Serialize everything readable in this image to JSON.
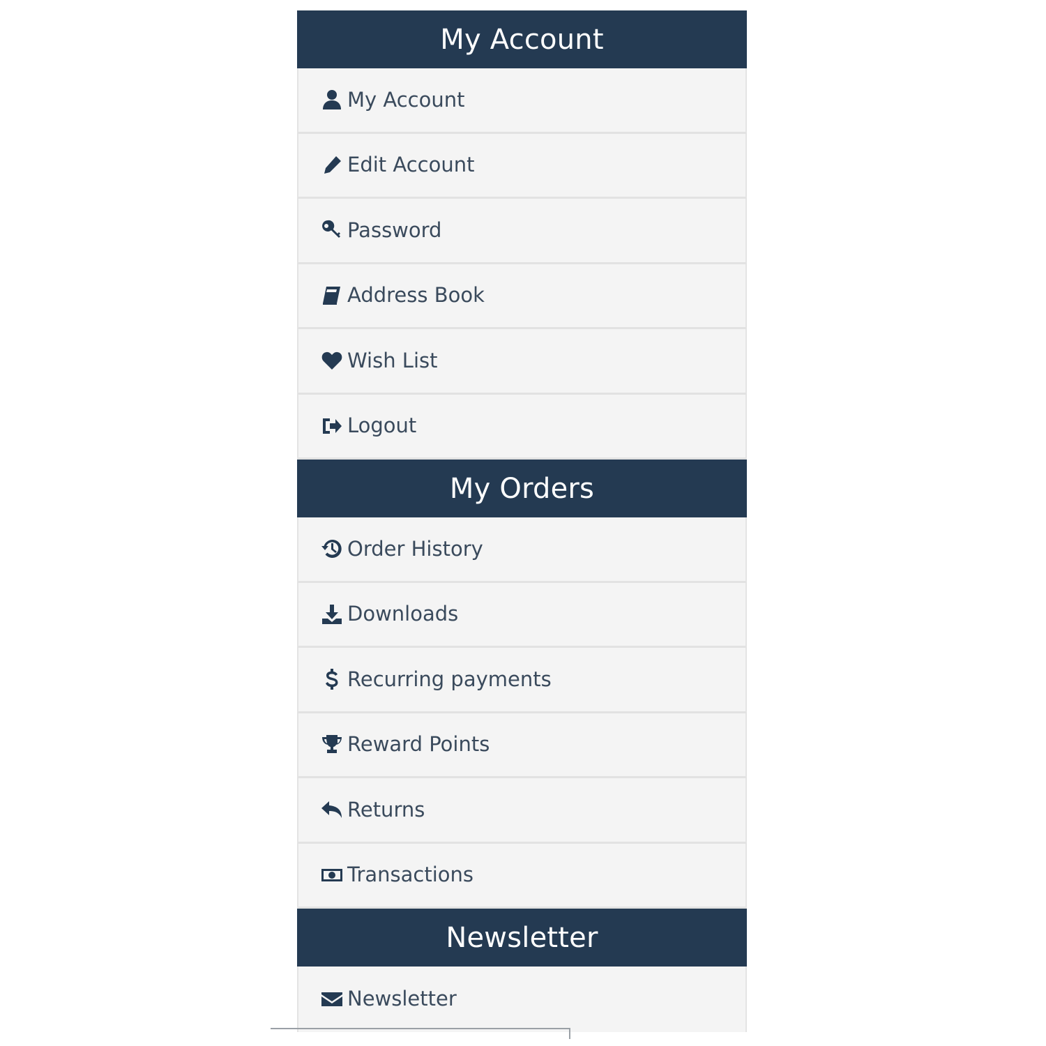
{
  "sections": [
    {
      "title": "My Account",
      "items": [
        {
          "label": "My Account",
          "icon": "user-icon"
        },
        {
          "label": "Edit Account",
          "icon": "pencil-icon"
        },
        {
          "label": "Password",
          "icon": "key-icon"
        },
        {
          "label": "Address Book",
          "icon": "book-icon"
        },
        {
          "label": "Wish List",
          "icon": "heart-icon"
        },
        {
          "label": "Logout",
          "icon": "sign-out-icon"
        }
      ]
    },
    {
      "title": "My Orders",
      "items": [
        {
          "label": "Order History",
          "icon": "history-icon"
        },
        {
          "label": "Downloads",
          "icon": "download-icon"
        },
        {
          "label": "Recurring payments",
          "icon": "dollar-icon"
        },
        {
          "label": "Reward Points",
          "icon": "trophy-icon"
        },
        {
          "label": "Returns",
          "icon": "reply-icon"
        },
        {
          "label": "Transactions",
          "icon": "money-icon"
        }
      ]
    },
    {
      "title": "Newsletter",
      "items": [
        {
          "label": "Newsletter",
          "icon": "envelope-icon"
        }
      ]
    }
  ],
  "colors": {
    "header_bg": "#243a52",
    "item_bg": "#f4f4f4",
    "text": "#3a4a5c"
  }
}
